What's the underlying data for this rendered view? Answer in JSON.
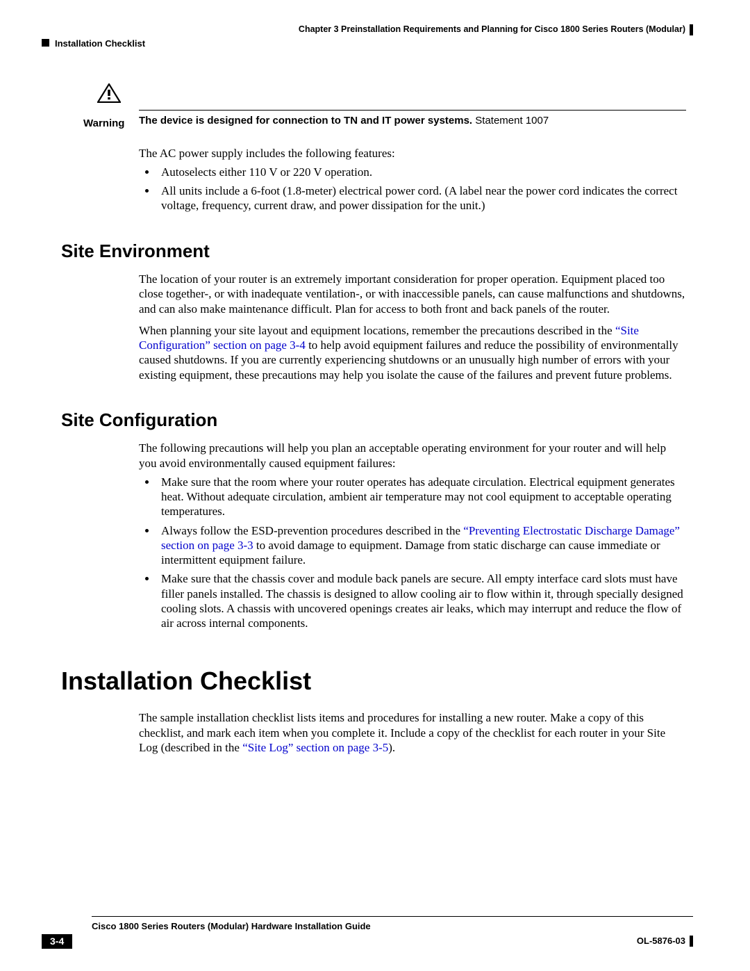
{
  "header": {
    "chapter": "Chapter 3      Preinstallation Requirements and Planning for Cisco 1800 Series Routers (Modular)",
    "section": "Installation Checklist"
  },
  "warning": {
    "label": "Warning",
    "bold": "The device is designed for connection to TN and IT power systems.",
    "tail": " Statement 1007"
  },
  "ac_intro": "The AC power supply includes the following features:",
  "ac_bullets": [
    "Autoselects either 110 V or 220 V operation.",
    "All units include a 6-foot (1.8-meter) electrical power cord. (A label near the power cord indicates the correct voltage, frequency, current draw, and power dissipation for the unit.)"
  ],
  "site_env": {
    "title": "Site Environment",
    "p1": "The location of your router is an extremely important consideration for proper operation. Equipment placed too close together-, or with inadequate ventilation-, or with inaccessible panels, can cause malfunctions and shutdowns, and can also make maintenance difficult. Plan for access to both front and back panels of the router.",
    "p2a": "When planning your site layout and equipment locations, remember the precautions described in the ",
    "link": "“Site Configuration” section on page 3-4",
    "p2b": " to help avoid equipment failures and reduce the possibility of environmentally caused shutdowns. If you are currently experiencing shutdowns or an unusually high number of errors with your existing equipment, these precautions may help you isolate the cause of the failures and prevent future problems."
  },
  "site_cfg": {
    "title": "Site Configuration",
    "intro": "The following precautions will help you plan an acceptable operating environment for your router and will help you avoid environmentally caused equipment failures:",
    "b1": "Make sure that the room where your router operates has adequate circulation. Electrical equipment generates heat. Without adequate circulation, ambient air temperature may not cool equipment to acceptable operating temperatures.",
    "b2a": "Always follow the ESD-prevention procedures described in the ",
    "b2link": "“Preventing Electrostatic Discharge Damage” section on page 3-3",
    "b2b": " to avoid damage to equipment. Damage from static discharge can cause immediate or intermittent equipment failure.",
    "b3": "Make sure that the chassis cover and module back panels are secure. All empty interface card slots must have filler panels installed. The chassis is designed to allow cooling air to flow within it, through specially designed cooling slots. A chassis with uncovered openings creates air leaks, which may interrupt and reduce the flow of air across internal components."
  },
  "install": {
    "title": "Installation Checklist",
    "p1a": "The sample installation checklist lists items and procedures for installing a new router. Make a copy of this checklist, and mark each item when you complete it. Include a copy of the checklist for each router in your Site Log (described in the ",
    "link": "“Site Log” section on page 3-5",
    "p1b": ")."
  },
  "footer": {
    "title": "Cisco 1800 Series Routers (Modular) Hardware Installation Guide",
    "page": "3-4",
    "doc": "OL-5876-03"
  }
}
